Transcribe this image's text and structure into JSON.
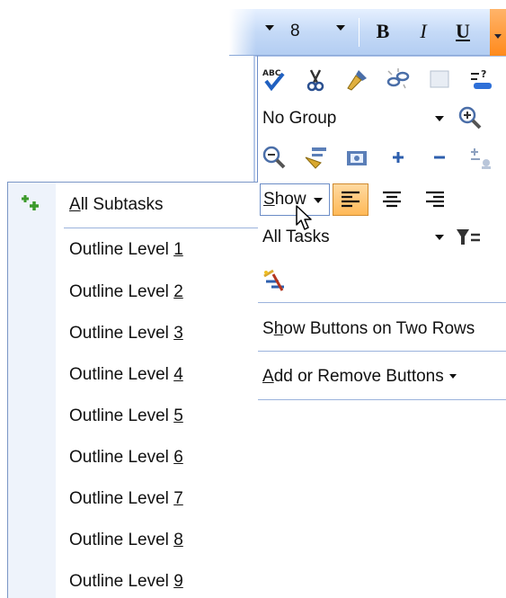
{
  "format_toolbar": {
    "font_size": "8",
    "bold_label": "B",
    "italic_label": "I",
    "underline_label": "U"
  },
  "toolbar": {
    "row1_icons": [
      "spelling-icon",
      "cut-icon",
      "format-painter-icon",
      "unlink-icon",
      "blank-icon",
      "task-info-icon"
    ],
    "group_combo": {
      "value": "No Group"
    },
    "row2_icons": [
      "zoom-out-icon",
      "task-notes-icon",
      "map-icon",
      "show-subtasks-plus-icon",
      "hide-subtasks-minus-icon",
      "assign-resources-icon"
    ],
    "show_button": {
      "prefix": "S",
      "suffix": "how"
    },
    "filter_combo": {
      "value": "All Tasks"
    },
    "commands": {
      "two_rows": {
        "prefix": "S",
        "underlined": "h",
        "suffix": "ow Buttons on Two Rows"
      },
      "add_remove": {
        "prefix": "",
        "underlined": "A",
        "suffix": "dd or Remove Buttons"
      }
    }
  },
  "submenu": {
    "items": [
      {
        "text": "All Subtasks",
        "underlined": "A",
        "rest": "ll Subtasks",
        "icon": "show-all-subtasks-icon"
      },
      {
        "prefix": "Outline Level ",
        "key": "1"
      },
      {
        "prefix": "Outline Level ",
        "key": "2"
      },
      {
        "prefix": "Outline Level ",
        "key": "3"
      },
      {
        "prefix": "Outline Level ",
        "key": "4"
      },
      {
        "prefix": "Outline Level ",
        "key": "5"
      },
      {
        "prefix": "Outline Level ",
        "key": "6"
      },
      {
        "prefix": "Outline Level ",
        "key": "7"
      },
      {
        "prefix": "Outline Level ",
        "key": "8"
      },
      {
        "prefix": "Outline Level ",
        "key": "9"
      }
    ]
  },
  "colors": {
    "toolbar_gradient_top": "#e6f0ff",
    "toolbar_gradient_bottom": "#b3cdf2",
    "active_button": "#ffb957",
    "menu_gutter": "#eef3fb",
    "border_blue": "#6b8cc6"
  }
}
